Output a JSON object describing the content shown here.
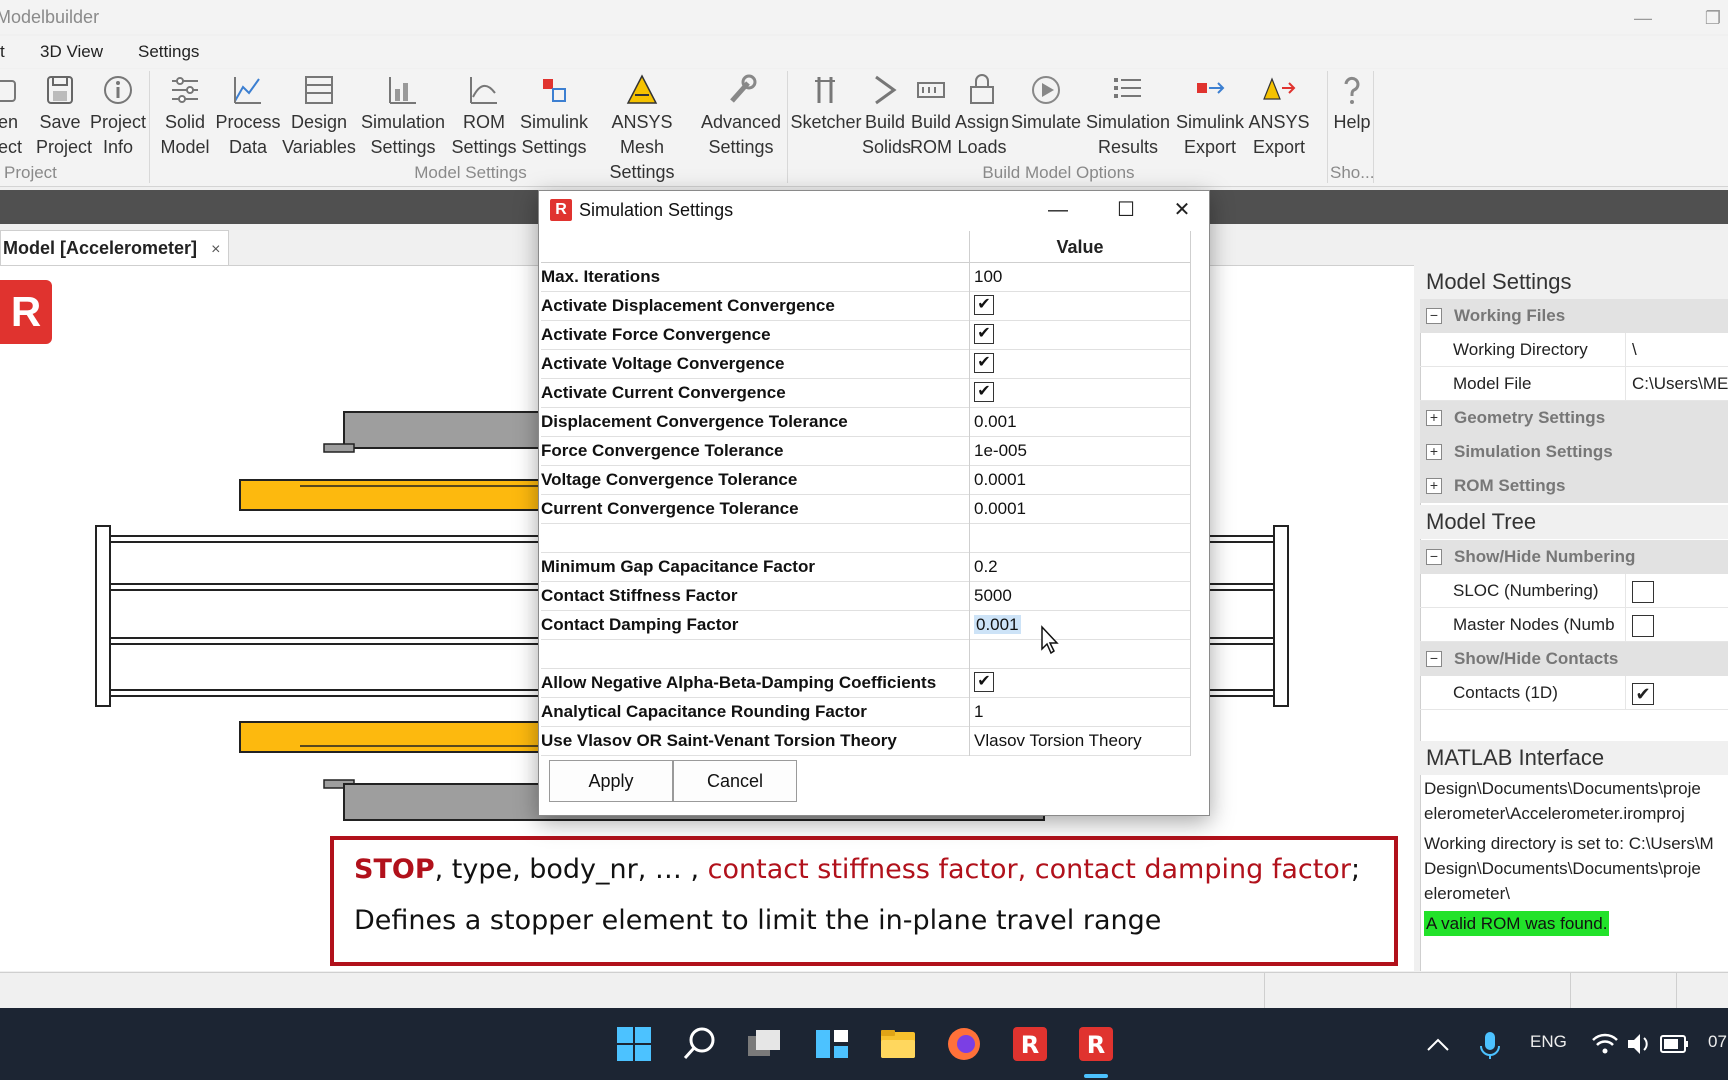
{
  "window": {
    "title": "Modelbuilder"
  },
  "menu": {
    "items": [
      "t",
      "3D View",
      "Settings"
    ]
  },
  "ribbon": {
    "project": {
      "label": "Project",
      "buttons": [
        {
          "line1": "en",
          "line2": "ject",
          "icon": "open-folder-icon"
        },
        {
          "line1": "Save",
          "line2": "Project",
          "icon": "save-icon"
        },
        {
          "line1": "Project",
          "line2": "Info",
          "icon": "info-icon"
        }
      ]
    },
    "model_settings": {
      "label": "Model Settings",
      "buttons": [
        {
          "line1": "Solid",
          "line2": "Model",
          "icon": "solid-model-icon"
        },
        {
          "line1": "Process",
          "line2": "Data",
          "icon": "process-data-icon"
        },
        {
          "line1": "Design",
          "line2": "Variables",
          "icon": "design-variables-icon"
        },
        {
          "line1": "Simulation",
          "line2": "Settings",
          "icon": "simulation-settings-icon"
        },
        {
          "line1": "ROM",
          "line2": "Settings",
          "icon": "rom-settings-icon"
        },
        {
          "line1": "Simulink",
          "line2": "Settings",
          "icon": "simulink-settings-icon"
        },
        {
          "line1": "ANSYS Mesh",
          "line2": "Settings",
          "icon": "ansys-mesh-icon"
        },
        {
          "line1": "Advanced",
          "line2": "Settings",
          "icon": "wrench-icon"
        }
      ]
    },
    "build_model": {
      "label": "Build Model Options",
      "buttons": [
        {
          "line1": "Sketcher",
          "line2": "",
          "icon": "sketcher-icon"
        },
        {
          "line1": "Build",
          "line2": "Solids",
          "icon": "build-solids-icon"
        },
        {
          "line1": "Build",
          "line2": "ROM",
          "icon": "build-rom-icon"
        },
        {
          "line1": "Assign",
          "line2": "Loads",
          "icon": "assign-loads-icon"
        },
        {
          "line1": "Simulate",
          "line2": "",
          "icon": "simulate-icon"
        },
        {
          "line1": "Simulation",
          "line2": "Results",
          "icon": "results-icon"
        },
        {
          "line1": "Simulink",
          "line2": "Export",
          "icon": "simulink-export-icon"
        },
        {
          "line1": "ANSYS",
          "line2": "Export",
          "icon": "ansys-export-icon"
        }
      ]
    },
    "show": {
      "label": "Sho...",
      "buttons": [
        {
          "line1": "Help",
          "line2": "",
          "icon": "help-icon"
        }
      ]
    }
  },
  "doc_tab": {
    "label": "Model [Accelerometer]",
    "close": "×"
  },
  "logo": {
    "glyph": "R"
  },
  "dialog": {
    "title": "Simulation Settings",
    "header_value": "Value",
    "rows": [
      {
        "key": "Max. Iterations",
        "value": "100",
        "type": "text"
      },
      {
        "key": "Activate Displacement Convergence",
        "value": "✔",
        "type": "check"
      },
      {
        "key": "Activate Force Convergence",
        "value": "✔",
        "type": "check"
      },
      {
        "key": "Activate Voltage Convergence",
        "value": "✔",
        "type": "check"
      },
      {
        "key": "Activate Current Convergence",
        "value": "✔",
        "type": "check"
      },
      {
        "key": "Displacement Convergence Tolerance",
        "value": "0.001",
        "type": "text"
      },
      {
        "key": "Force Convergence Tolerance",
        "value": "1e-005",
        "type": "text"
      },
      {
        "key": "Voltage Convergence Tolerance",
        "value": "0.0001",
        "type": "text"
      },
      {
        "key": "Current Convergence Tolerance",
        "value": "0.0001",
        "type": "text"
      },
      {
        "key": "",
        "value": "",
        "type": "blank"
      },
      {
        "key": "Minimum Gap Capacitance Factor",
        "value": "0.2",
        "type": "text"
      },
      {
        "key": "Contact Stiffness Factor",
        "value": "5000",
        "type": "text"
      },
      {
        "key": "Contact Damping Factor",
        "value": "0.001",
        "type": "selected"
      },
      {
        "key": "",
        "value": "",
        "type": "blank"
      },
      {
        "key": "Allow Negative Alpha-Beta-Damping Coefficients",
        "value": "✔",
        "type": "check"
      },
      {
        "key": "Analytical Capacitance Rounding Factor",
        "value": "1",
        "type": "text"
      },
      {
        "key": "Use Vlasov OR Saint-Venant Torsion Theory",
        "value": "Vlasov Torsion Theory",
        "type": "text"
      }
    ],
    "apply_label": "Apply",
    "cancel_label": "Cancel"
  },
  "infobox": {
    "stop": "STOP",
    "middle": ", type, body_nr, … , ",
    "red": "contact stiffness factor, contact damping factor",
    "end": ";",
    "line2": "Defines a stopper element to limit the in-plane travel range"
  },
  "right_panel": {
    "model_settings_title": "Model Settings",
    "working_files": "Working Files",
    "working_directory_label": "Working Directory",
    "working_directory_value": "\\",
    "model_file_label": "Model File",
    "model_file_value": "C:\\Users\\MEM",
    "geometry_settings": "Geometry Settings",
    "simulation_settings": "Simulation Settings",
    "rom_settings": "ROM Settings",
    "model_tree_title": "Model Tree",
    "show_hide_numbering": "Show/Hide Numbering",
    "sloc_label": "SLOC (Numbering)",
    "master_nodes_label": "Master Nodes (Numb",
    "show_hide_contacts": "Show/Hide Contacts",
    "contacts_label": "Contacts (1D)",
    "check": "✔",
    "minus": "−",
    "plus": "+",
    "matlab_title": "MATLAB Interface",
    "matlab_lines": [
      "Design\\Documents\\Documents\\proje",
      "elerometer\\Accelerometer.iromproj",
      "Working directory is set to: C:\\Users\\M",
      "Design\\Documents\\Documents\\proje",
      "elerometer\\"
    ],
    "matlab_ok": "A valid ROM was found."
  },
  "taskbar": {
    "lang": "ENG",
    "clock": "07"
  },
  "colors": {
    "accent_red": "#e0332f",
    "stop_red": "#b1111b",
    "mass_orange": "#fdb90e",
    "anchor_gray": "#9e9e9e",
    "taskbar": "#1c2533"
  }
}
